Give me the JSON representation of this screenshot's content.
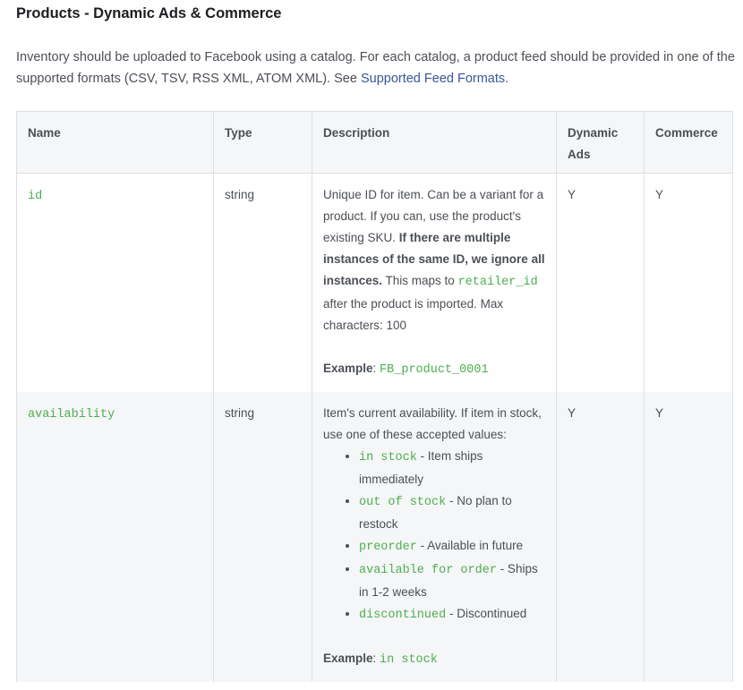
{
  "title": "Products - Dynamic Ads & Commerce",
  "intro": {
    "text_before_link": "Inventory should be uploaded to Facebook using a catalog. For each catalog, a product feed should be provided in one of the supported formats (CSV, TSV, RSS XML, ATOM XML). See ",
    "link_label": "Supported Feed Formats",
    "text_after_link": "."
  },
  "table": {
    "headers": [
      "Name",
      "Type",
      "Description",
      "Dynamic Ads",
      "Commerce"
    ],
    "rows": [
      {
        "name": "id",
        "type": "string",
        "desc_part1": "Unique ID for item. Can be a variant for a product. If you can, use the product's existing SKU. ",
        "desc_bold": "If there are multiple instances of the same ID, we ignore all instances.",
        "desc_part2": " This maps to ",
        "desc_code": "retailer_id",
        "desc_part3": " after the product is imported. Max characters: 100",
        "example_label": "Example",
        "example_value": "FB_product_0001",
        "dynamic_ads": "Y",
        "commerce": "Y"
      },
      {
        "name": "availability",
        "type": "string",
        "desc_intro": "Item's current availability. If item in stock, use one of these accepted values:",
        "values": [
          {
            "code": "in stock",
            "text": " - Item ships immediately"
          },
          {
            "code": "out of stock",
            "text": " - No plan to restock"
          },
          {
            "code": "preorder",
            "text": " - Available in future"
          },
          {
            "code": "available for order",
            "text": " - Ships in 1-2 weeks"
          },
          {
            "code": "discontinued",
            "text": " - Discontinued"
          }
        ],
        "example_label": "Example",
        "example_value": "in stock",
        "dynamic_ads": "Y",
        "commerce": "Y"
      }
    ]
  },
  "colors": {
    "code": "#4caf50",
    "link": "#365899",
    "header_bg": "#f5f6f7",
    "border": "#dddfe2"
  }
}
